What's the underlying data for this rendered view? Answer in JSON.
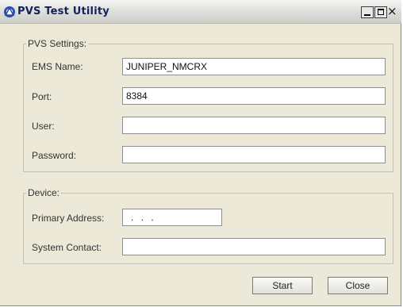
{
  "window": {
    "title": "PVS Test Utility",
    "icon": "pvs-app-icon",
    "controls": {
      "minimize": "minimize-icon",
      "maximize": "maximize-icon",
      "close": "×"
    }
  },
  "pvs_settings": {
    "legend": "PVS Settings:",
    "ems_name": {
      "label": "EMS Name:",
      "value": "JUNIPER_NMCRX"
    },
    "port": {
      "label": "Port:",
      "value": "8384"
    },
    "user": {
      "label": "User:",
      "value": ""
    },
    "password": {
      "label": "Password:",
      "value": ""
    }
  },
  "device": {
    "legend": "Device:",
    "primary_address": {
      "label": "Primary Address:",
      "value": ". . ."
    },
    "system_contact": {
      "label": "System Contact:",
      "value": ""
    }
  },
  "buttons": {
    "start": "Start",
    "close": "Close"
  },
  "colors": {
    "window_bg": "#ece9d8",
    "title_text": "#14225a",
    "border": "#c4c2b8"
  }
}
